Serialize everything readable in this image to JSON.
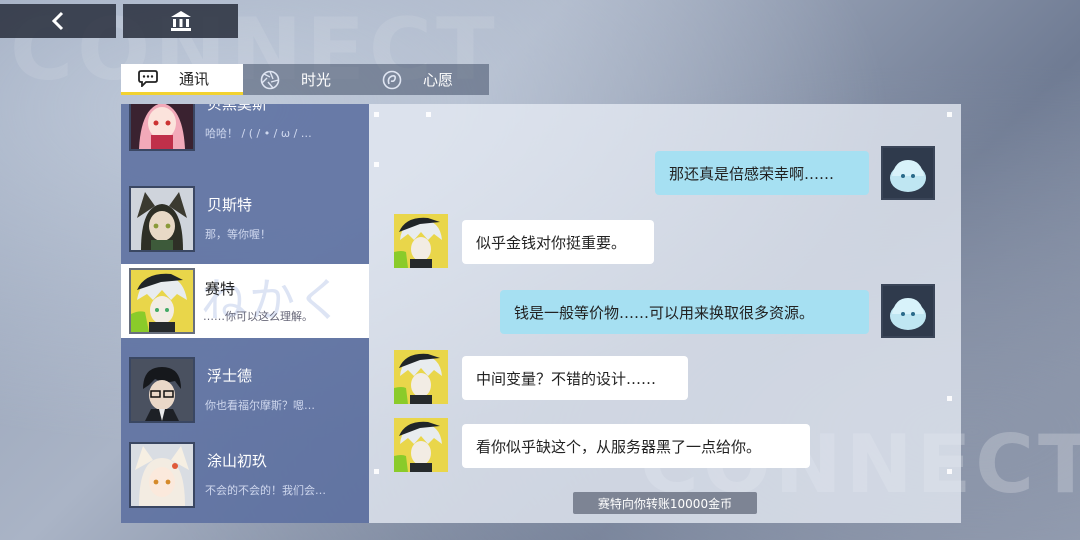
{
  "background": {
    "watermark_top": "CONNECT",
    "watermark_bottom": "CONNECT"
  },
  "topbar": {
    "back_icon": "chevron-left-icon",
    "home_icon": "bank-icon"
  },
  "tabs": [
    {
      "label": "通讯",
      "icon": "chat-bubble-icon",
      "active": true
    },
    {
      "label": "时光",
      "icon": "aperture-icon",
      "active": false
    },
    {
      "label": "心愿",
      "icon": "wish-icon",
      "active": false
    }
  ],
  "contacts": [
    {
      "name": "贝黑莫斯",
      "preview": "哈哈！ / ( / • / ω / …",
      "active": false
    },
    {
      "name": "贝斯特",
      "preview": "那，等你喔！",
      "active": false
    },
    {
      "name": "赛特",
      "preview": "……你可以这么理解。",
      "active": true,
      "watermark": "ねかく"
    },
    {
      "name": "浮士德",
      "preview": "你也看福尔摩斯？嗯…",
      "active": false
    },
    {
      "name": "涂山初玖",
      "preview": "不会的不会的！我们会…",
      "active": false
    }
  ],
  "messages": [
    {
      "sender": "me",
      "text": "那还真是倍感荣幸啊……"
    },
    {
      "sender": "them",
      "text": "似乎金钱对你挺重要。"
    },
    {
      "sender": "me",
      "text": "钱是一般等价物……可以用来换取很多资源。"
    },
    {
      "sender": "them",
      "text": "中间变量？不错的设计……"
    },
    {
      "sender": "them",
      "text": "看你似乎缺这个，从服务器黑了一点给你。"
    }
  ],
  "system_note": "赛特向你转账10000金币",
  "colors": {
    "accent_yellow": "#f2d230",
    "my_bubble": "#a6e0f2",
    "their_bubble": "#ffffff",
    "contact_list_bg": "#5c70a0"
  }
}
